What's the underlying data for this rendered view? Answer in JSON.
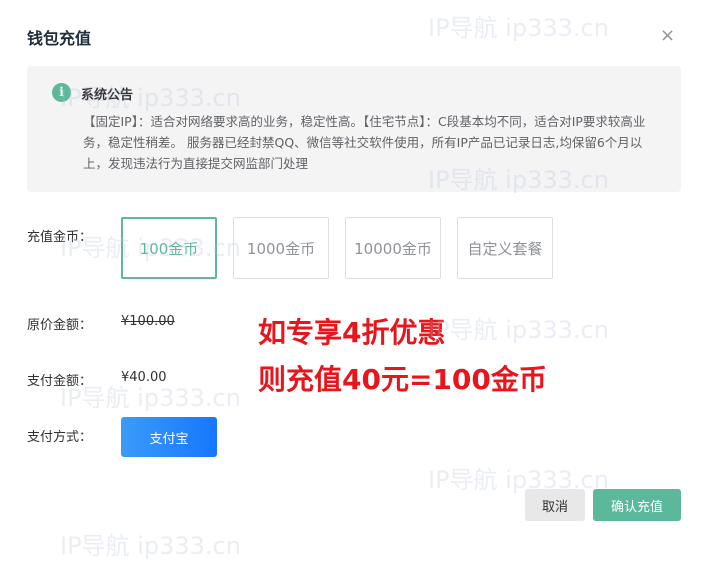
{
  "dialog": {
    "title": "钱包充值",
    "close_symbol": "×"
  },
  "notice": {
    "icon_glyph": "i",
    "title": "系统公告",
    "body": "【固定IP】：适合对网络要求高的业务，稳定性高。【住宅节点】：C段基本均不同，适合对IP要求较高业务，稳定性稍差。 服务器已经封禁QQ、微信等社交软件使用，所有IP产品已记录日志,均保留6个月以上，发现违法行为直接提交网监部门处理"
  },
  "form": {
    "coin_label": "充值金币：",
    "coin_options": [
      {
        "label": "100金币",
        "selected": true
      },
      {
        "label": "1000金币",
        "selected": false
      },
      {
        "label": "10000金币",
        "selected": false
      },
      {
        "label": "自定义套餐",
        "selected": false
      }
    ],
    "original_label": "原价金额：",
    "original_value": "¥100.00",
    "pay_label": "支付金额：",
    "pay_value": "¥40.00",
    "method_label": "支付方式：",
    "method_button": "支付宝"
  },
  "promo": {
    "line1": "如专享4折优惠",
    "line2": "则充值40元=100金币",
    "color": "#e8161c"
  },
  "footer": {
    "cancel_label": "取消",
    "confirm_label": "确认充值"
  },
  "watermark": {
    "text": "IP导航  ip333.cn"
  },
  "colors": {
    "accent": "#5cb89a",
    "alipay": "#1677ff"
  }
}
